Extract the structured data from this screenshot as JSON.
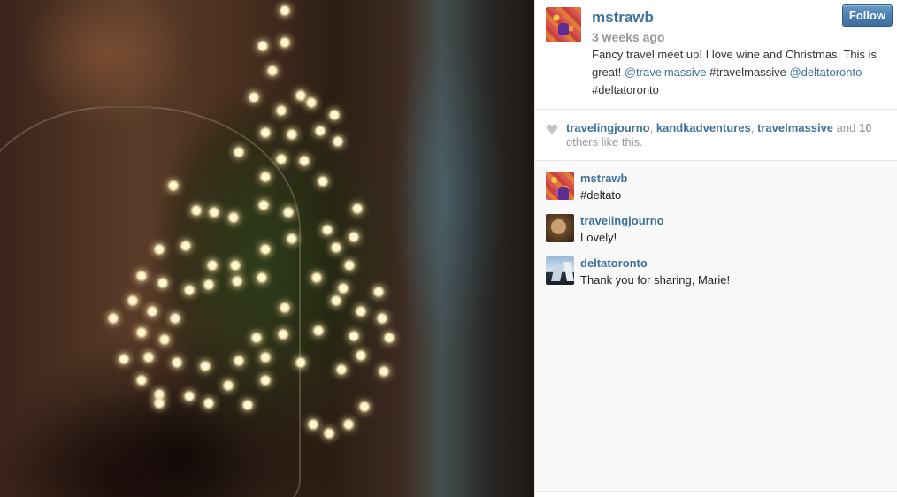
{
  "post": {
    "username": "mstrawb",
    "follow_label": "Follow",
    "timestamp": "3 weeks ago",
    "caption": {
      "part1": "Fancy travel meet up! I love wine and Christmas. This is great! ",
      "mention1": "@travelmassive",
      "tag1": " #travelmassive ",
      "mention2": "@deltatoronto",
      "tag2": "#deltatoronto"
    }
  },
  "likes": {
    "likers": [
      "travelingjourno",
      "kandkadventures",
      "travelmassive"
    ],
    "sep": ", ",
    "and_text": " and ",
    "count": "10",
    "suffix": " others like this."
  },
  "comments": [
    {
      "username": "mstrawb",
      "text": "#deltato"
    },
    {
      "username": "travelingjourno",
      "text": "Lovely!"
    },
    {
      "username": "deltatoronto",
      "text": "Thank you for sharing, Marie!"
    }
  ],
  "colors": {
    "link": "#3f729b",
    "muted": "#999999",
    "follow_button": "#4b7fb0"
  },
  "icons": {
    "like": "heart-icon"
  }
}
